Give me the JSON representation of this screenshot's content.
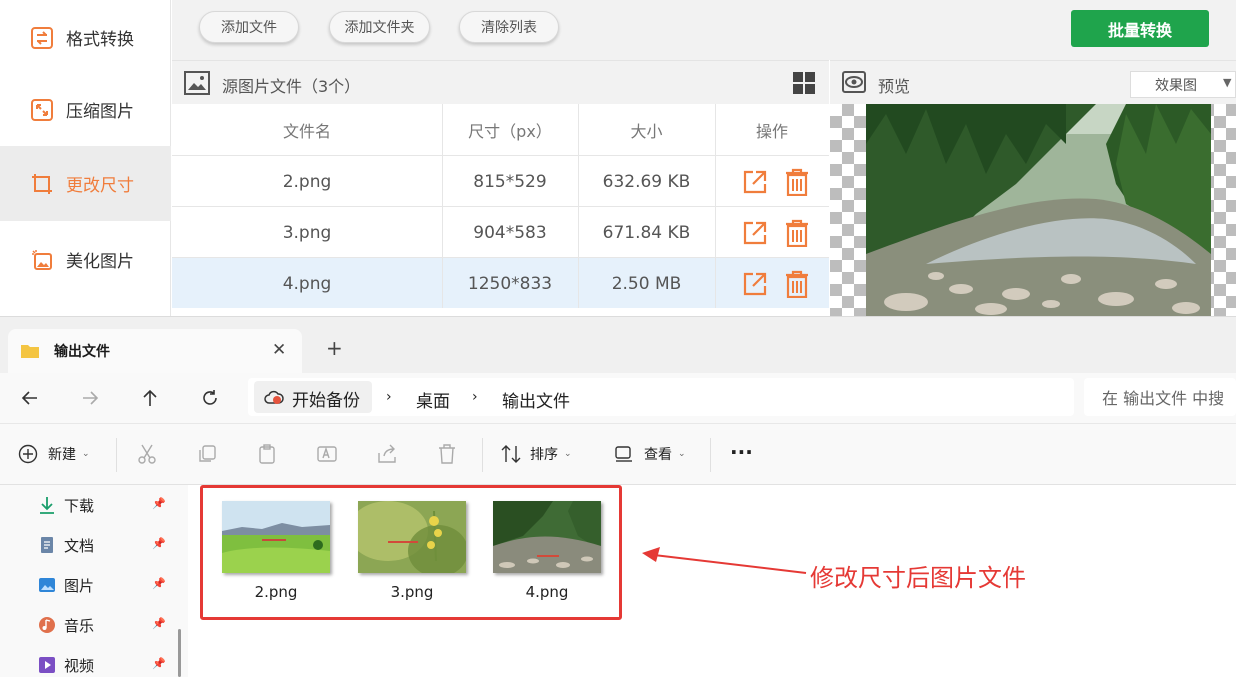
{
  "sidebar": {
    "items": [
      {
        "label": "格式转换",
        "icon": "format-convert-icon"
      },
      {
        "label": "压缩图片",
        "icon": "compress-icon"
      },
      {
        "label": "更改尺寸",
        "icon": "resize-icon",
        "active": true
      },
      {
        "label": "美化图片",
        "icon": "beautify-icon"
      }
    ]
  },
  "toolbar": {
    "add_file": "添加文件",
    "add_folder": "添加文件夹",
    "clear_list": "清除列表",
    "batch_convert": "批量转换"
  },
  "file_list": {
    "title": "源图片文件（3个）",
    "columns": [
      "文件名",
      "尺寸（px）",
      "大小",
      "操作"
    ],
    "rows": [
      {
        "name": "2.png",
        "size_px": "815*529",
        "size": "632.69 KB"
      },
      {
        "name": "3.png",
        "size_px": "904*583",
        "size": "671.84 KB"
      },
      {
        "name": "4.png",
        "size_px": "1250*833",
        "size": "2.50 MB",
        "selected": true
      }
    ]
  },
  "preview": {
    "title": "预览",
    "view_mode": "效果图"
  },
  "explorer": {
    "tab_title": "输出文件",
    "breadcrumb": [
      "开始备份",
      "桌面",
      "输出文件"
    ],
    "search_placeholder": "在 输出文件 中搜",
    "commands": {
      "new": "新建",
      "sort": "排序",
      "view": "查看",
      "more": "···"
    },
    "nav_items": [
      {
        "label": "下载",
        "icon": "download-icon"
      },
      {
        "label": "文档",
        "icon": "document-icon"
      },
      {
        "label": "图片",
        "icon": "pictures-icon"
      },
      {
        "label": "音乐",
        "icon": "music-icon"
      },
      {
        "label": "视频",
        "icon": "video-icon"
      }
    ],
    "files": [
      {
        "name": "2.png"
      },
      {
        "name": "3.png"
      },
      {
        "name": "4.png"
      }
    ],
    "annotation": "修改尺寸后图片文件"
  },
  "colors": {
    "accent": "#f07d3c",
    "green": "#1fa44c",
    "annotation": "#e53935"
  }
}
